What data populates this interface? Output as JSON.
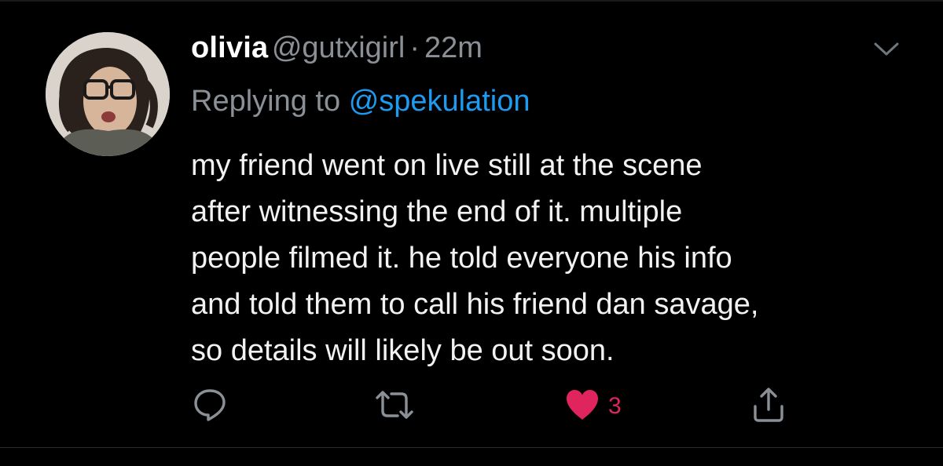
{
  "tweet": {
    "display_name": "olivia",
    "handle": "@gutxigirl",
    "separator": "·",
    "time": "22m",
    "reply_prefix": "Replying to",
    "reply_to": "@spekulation",
    "body_lines": [
      "my friend went on live still at the scene",
      "after witnessing the end of it. multiple",
      "people filmed it. he told everyone his info",
      "and told them to call his friend dan savage,",
      "so details will likely be out soon."
    ],
    "likes": "3",
    "liked": true
  },
  "icons": {
    "reply": "reply-icon",
    "retweet": "retweet-icon",
    "like": "heart-icon",
    "share": "share-icon",
    "menu": "chevron-down-icon"
  },
  "colors": {
    "background": "#000000",
    "link": "#1d9bf0",
    "muted": "#8a9096",
    "like": "#e0245e"
  }
}
